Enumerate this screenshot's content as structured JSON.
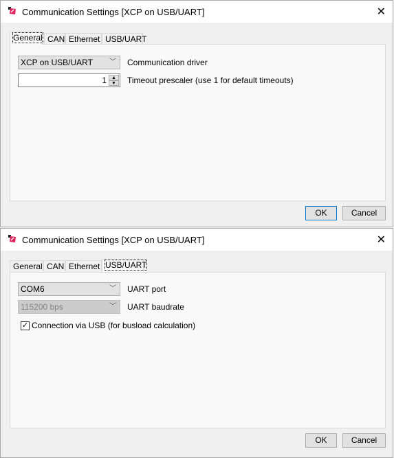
{
  "dialogs": [
    {
      "title": "Communication Settings [XCP on USB/UART]",
      "tabs": [
        "General",
        "CAN",
        "Ethernet",
        "USB/UART"
      ],
      "selected_tab": "General",
      "driver": {
        "value": "XCP on USB/UART",
        "label": "Communication driver"
      },
      "prescaler": {
        "value": "1",
        "label": "Timeout prescaler (use 1 for default timeouts)"
      },
      "ok": "OK",
      "cancel": "Cancel"
    },
    {
      "title": "Communication Settings [XCP on USB/UART]",
      "tabs": [
        "General",
        "CAN",
        "Ethernet",
        "USB/UART"
      ],
      "selected_tab": "USB/UART",
      "port": {
        "value": "COM6",
        "label": "UART port"
      },
      "baudrate": {
        "value": "115200 bps",
        "label": "UART baudrate",
        "disabled": true
      },
      "usb": {
        "label": "Connection via USB (for busload calculation)",
        "checked": true
      },
      "ok": "OK",
      "cancel": "Cancel"
    }
  ],
  "icons": {
    "app": "app-logo-icon",
    "close": "close-icon",
    "dropdown": "chevron-down-icon"
  }
}
